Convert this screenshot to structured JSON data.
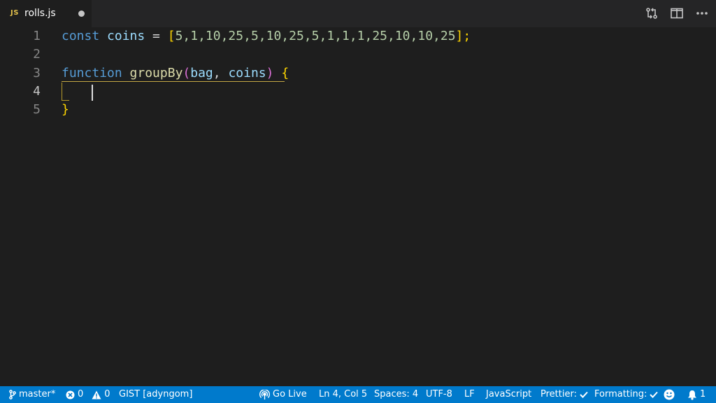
{
  "tab": {
    "lang_badge": "JS",
    "file_name": "rolls.js"
  },
  "editor": {
    "line_numbers": [
      "1",
      "2",
      "3",
      "4",
      "5"
    ],
    "current_line": 4,
    "lines": {
      "l1": {
        "kw": "const",
        "name": "coins",
        "eq": " = ",
        "open": "[",
        "values": "5,1,10,25,5,10,25,5,1,1,1,25,10,10,25",
        "close": "];"
      },
      "l3": {
        "kw": "function",
        "name": "groupBy",
        "open": "(",
        "p1": "bag",
        "comma": ", ",
        "p2": "coins",
        "close": ")",
        "brace": " {"
      },
      "l5": {
        "brace": "}"
      }
    }
  },
  "status": {
    "branch": "master*",
    "errors": "0",
    "warnings": "0",
    "gist": "GIST [adyngom]",
    "go_live": "Go Live",
    "position": "Ln 4, Col 5",
    "spaces": "Spaces: 4",
    "encoding": "UTF-8",
    "eol": "LF",
    "language": "JavaScript",
    "prettier": "Prettier:",
    "formatting": "Formatting:",
    "notifications": "1"
  },
  "icons": {
    "tab_actions": [
      "compare-changes-icon",
      "split-editor-icon",
      "more-actions-icon"
    ],
    "status": [
      "git-branch-icon",
      "error-icon",
      "warning-icon",
      "broadcast-icon",
      "check-icon",
      "smiley-icon",
      "bell-icon"
    ]
  },
  "colors": {
    "status_bar": "#007acc",
    "editor_bg": "#1e1e1e",
    "tab_bar_bg": "#252526",
    "js_badge": "#e2c04b"
  }
}
